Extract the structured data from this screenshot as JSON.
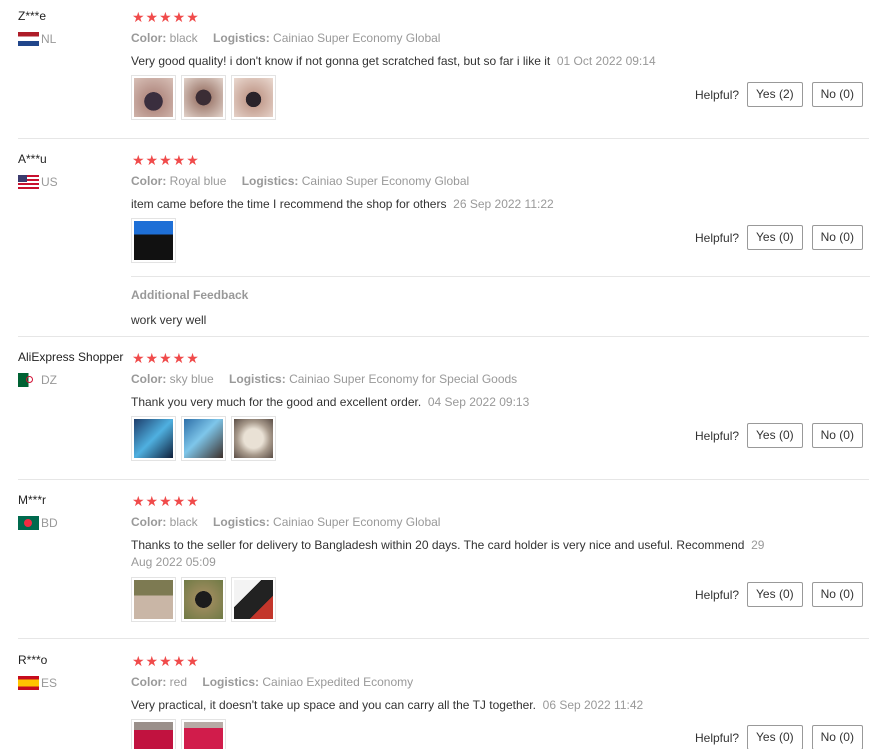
{
  "reviews": [
    {
      "user": "Z***e",
      "country": "NL",
      "stars": "★★★★★",
      "color_label": "Color:",
      "color": "black",
      "logistics_label": "Logistics:",
      "logistics": "Cainiao Super Economy Global",
      "text": "Very good quality! i don't know if not gonna get scratched fast, but so far i like it",
      "date": "01 Oct 2022 09:14",
      "helpful_label": "Helpful?",
      "yes": "Yes (2)",
      "no": "No (0)"
    },
    {
      "user": "A***u",
      "country": "US",
      "stars": "★★★★★",
      "color_label": "Color:",
      "color": "Royal blue",
      "logistics_label": "Logistics:",
      "logistics": "Cainiao Super Economy Global",
      "text": "item came before the time I recommend the shop for others",
      "date": "26 Sep 2022 11:22",
      "helpful_label": "Helpful?",
      "yes": "Yes (0)",
      "no": "No (0)",
      "additional_title": "Additional Feedback",
      "additional_text": "work very well"
    },
    {
      "user": "AliExpress Shopper",
      "country": "DZ",
      "stars": "★★★★★",
      "color_label": "Color:",
      "color": "sky blue",
      "logistics_label": "Logistics:",
      "logistics": "Cainiao Super Economy for Special Goods",
      "text": "Thank you very much for the good and excellent order.",
      "date": "04 Sep 2022 09:13",
      "helpful_label": "Helpful?",
      "yes": "Yes (0)",
      "no": "No (0)"
    },
    {
      "user": "M***r",
      "country": "BD",
      "stars": "★★★★★",
      "color_label": "Color:",
      "color": "black",
      "logistics_label": "Logistics:",
      "logistics": "Cainiao Super Economy Global",
      "text": "Thanks to the seller for delivery to Bangladesh within 20 days. The card holder is very nice and useful. Recommend",
      "date": "29 Aug 2022 05:09",
      "helpful_label": "Helpful?",
      "yes": "Yes (0)",
      "no": "No (0)"
    },
    {
      "user": "R***o",
      "country": "ES",
      "stars": "★★★★★",
      "color_label": "Color:",
      "color": "red",
      "logistics_label": "Logistics:",
      "logistics": "Cainiao Expedited Economy",
      "text": "Very practical, it doesn't take up space and you can carry all the TJ together.",
      "date": "06 Sep 2022 11:42",
      "helpful_label": "Helpful?",
      "yes": "Yes (0)",
      "no": "No (0)"
    }
  ],
  "colors": {
    "star": "#f04b4b",
    "muted": "#999999",
    "divider": "#e6e6e6"
  }
}
